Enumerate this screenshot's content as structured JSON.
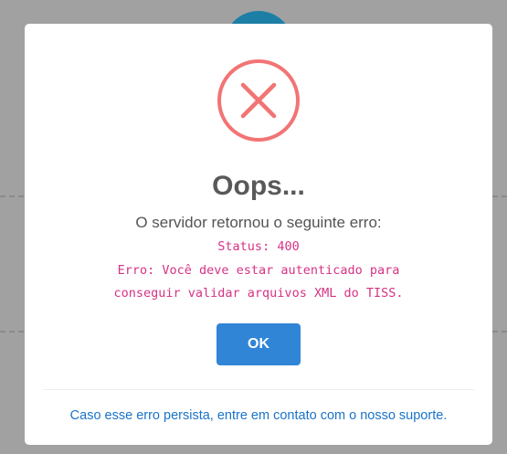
{
  "dialog": {
    "icon": "error-x-icon",
    "title": "Oops...",
    "message": "O servidor retornou o seguinte erro:",
    "error_status": "Status: 400",
    "error_line_1": "Erro: Você deve estar autenticado para",
    "error_line_2": "conseguir validar arquivos XML do TISS.",
    "confirm_label": "OK",
    "footer_link": "Caso esse erro persista, entre em contato com o nosso suporte."
  },
  "colors": {
    "error_icon": "#f27474",
    "confirm_button": "#3085d6",
    "error_code_text": "#d63384",
    "link": "#1a73c9"
  }
}
